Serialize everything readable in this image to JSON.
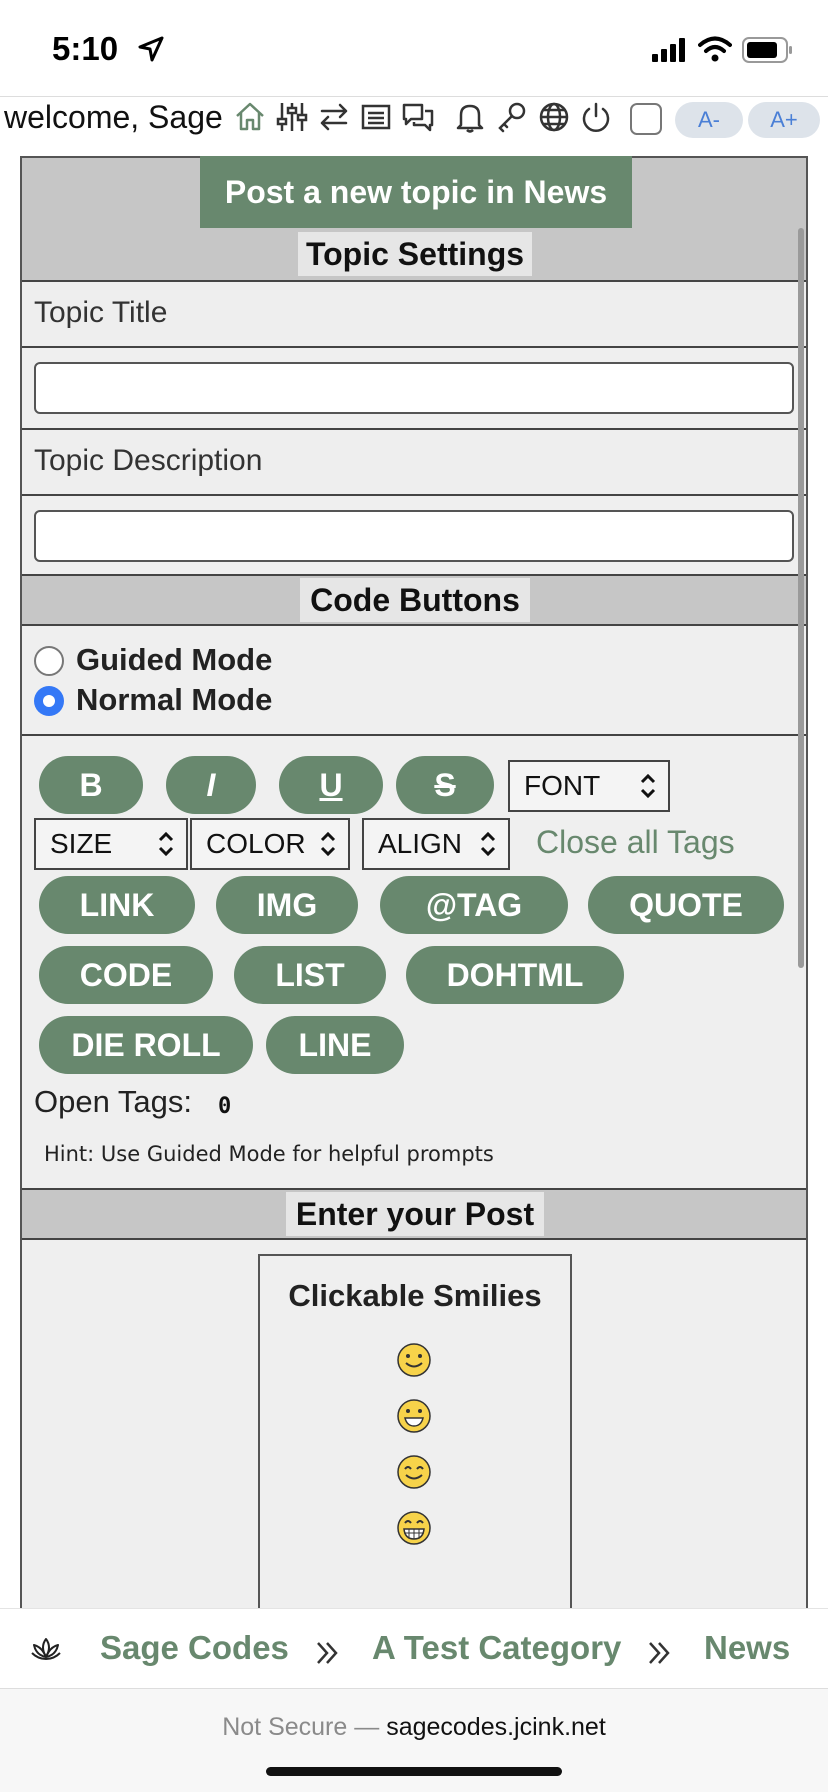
{
  "status_bar": {
    "time": "5:10"
  },
  "top_bar": {
    "welcome": "welcome, Sage",
    "font_smaller": "A-",
    "font_larger": "A+"
  },
  "header": {
    "title": "Post a new topic in News"
  },
  "topic_settings": {
    "heading": "Topic Settings",
    "title_label": "Topic Title",
    "title_value": "",
    "description_label": "Topic Description",
    "description_value": ""
  },
  "code_buttons": {
    "heading": "Code Buttons",
    "modes": [
      {
        "label": "Guided Mode",
        "selected": false
      },
      {
        "label": "Normal Mode",
        "selected": true
      }
    ],
    "format_buttons": [
      "B",
      "I",
      "U",
      "S"
    ],
    "selects": {
      "font": "FONT",
      "size": "SIZE",
      "color": "COLOR",
      "align": "ALIGN"
    },
    "close_all": "Close all Tags",
    "tag_buttons": [
      "LINK",
      "IMG",
      "@TAG",
      "QUOTE",
      "CODE",
      "LIST",
      "DOHTML",
      "DIE ROLL",
      "LINE"
    ],
    "open_tags_label": "Open Tags:",
    "open_tags_count": "0",
    "hint": "Hint: Use Guided Mode for helpful prompts"
  },
  "post": {
    "heading": "Enter your Post",
    "smilies_title": "Clickable Smilies",
    "smilies": [
      "smile",
      "grin",
      "happy",
      "big-grin"
    ]
  },
  "breadcrumb": {
    "items": [
      "Sage Codes",
      "A Test Category",
      "News"
    ]
  },
  "browser": {
    "security": "Not Secure —",
    "domain": "sagecodes.jcink.net"
  },
  "colors": {
    "accent": "#68886e",
    "band": "#c6c6c6",
    "panel": "#efefef",
    "link_blue": "#4a7fd6",
    "radio_blue": "#3478f6"
  }
}
